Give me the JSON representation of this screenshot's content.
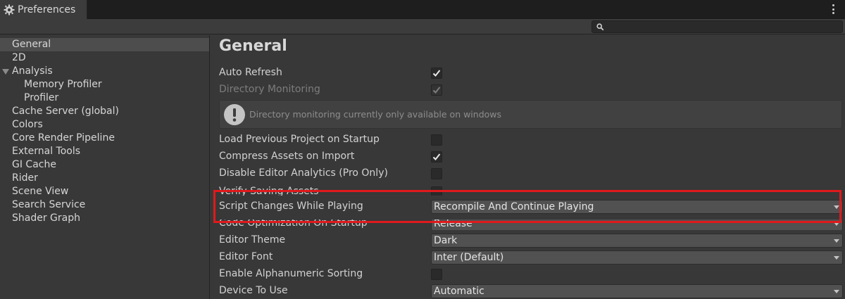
{
  "window": {
    "tab_title": "Preferences"
  },
  "search": {
    "placeholder": ""
  },
  "sidebar": {
    "items": [
      {
        "label": "General",
        "selected": true
      },
      {
        "label": "2D"
      },
      {
        "label": "Analysis",
        "expanded": true
      },
      {
        "label": "Memory Profiler"
      },
      {
        "label": "Profiler"
      },
      {
        "label": "Cache Server (global)"
      },
      {
        "label": "Colors"
      },
      {
        "label": "Core Render Pipeline"
      },
      {
        "label": "External Tools"
      },
      {
        "label": "GI Cache"
      },
      {
        "label": "Rider"
      },
      {
        "label": "Scene View"
      },
      {
        "label": "Search Service"
      },
      {
        "label": "Shader Graph"
      }
    ]
  },
  "main": {
    "title": "General",
    "help_message": "Directory monitoring currently only available on windows",
    "settings": [
      {
        "label": "Auto Refresh",
        "checked": true
      },
      {
        "label": "Directory Monitoring",
        "checked": true,
        "disabled": true
      },
      {
        "label": "Load Previous Project on Startup",
        "checked": false
      },
      {
        "label": "Compress Assets on Import",
        "checked": true
      },
      {
        "label": "Disable Editor Analytics (Pro Only)",
        "checked": false
      },
      {
        "label": "Verify Saving Assets",
        "checked": false
      },
      {
        "label": "Script Changes While Playing",
        "value": "Recompile And Continue Playing"
      },
      {
        "label": "Code Optimization On Startup",
        "value": "Release"
      },
      {
        "label": "Editor Theme",
        "value": "Dark"
      },
      {
        "label": "Editor Font",
        "value": "Inter (Default)"
      },
      {
        "label": "Enable Alphanumeric Sorting",
        "checked": false
      },
      {
        "label": "Device To Use",
        "value": "Automatic"
      }
    ]
  },
  "colors": {
    "highlight": "#e0191c",
    "selected_bg": "#4d4d4d"
  }
}
